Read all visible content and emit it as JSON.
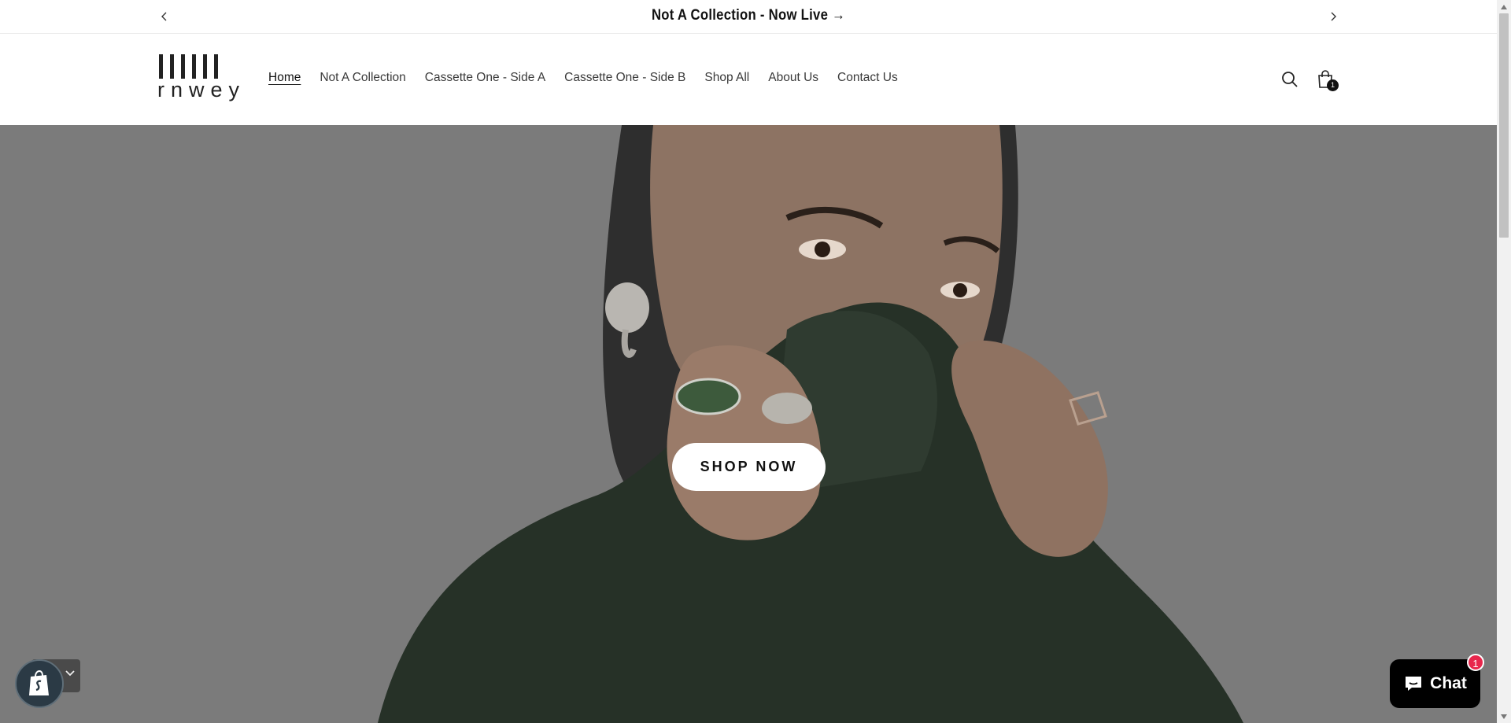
{
  "announcement": {
    "message": "Not A Collection - Now Live →",
    "prev_icon": "chevron-left-icon",
    "next_icon": "chevron-right-icon"
  },
  "header": {
    "logo_text": "rnwey",
    "nav": [
      {
        "label": "Home",
        "active": true
      },
      {
        "label": "Not A Collection",
        "active": false
      },
      {
        "label": "Cassette One - Side A",
        "active": false
      },
      {
        "label": "Cassette One - Side B",
        "active": false
      },
      {
        "label": "Shop All",
        "active": false
      },
      {
        "label": "About Us",
        "active": false
      },
      {
        "label": "Contact Us",
        "active": false
      }
    ],
    "search_icon": "search-icon",
    "cart_icon": "shopping-bag-icon",
    "cart_count": "1"
  },
  "hero": {
    "cta_label": "SHOP NOW"
  },
  "chat": {
    "label": "Chat",
    "badge": "1"
  },
  "colors": {
    "hero_overlay": "#7b7b7b",
    "chat_badge": "#e8264c",
    "shopify_badge": "#2b3a45"
  }
}
